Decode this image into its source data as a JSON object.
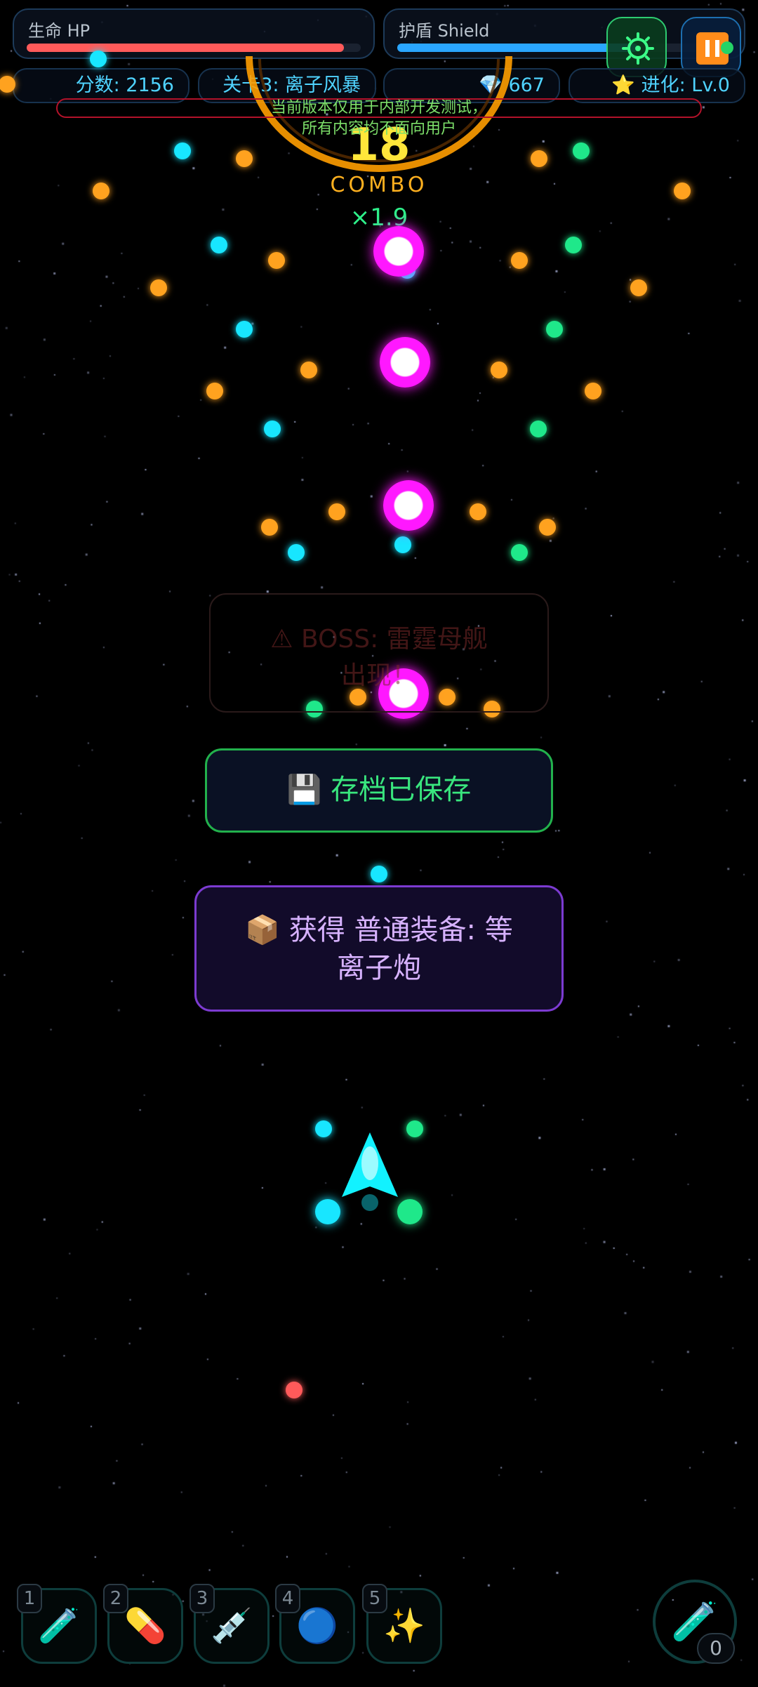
{
  "hud": {
    "hp_label": "生命 HP",
    "hp_fraction": 0.95,
    "shield_label": "护盾 Shield",
    "shield_fraction": 0.72,
    "score": "分数: 2156",
    "level": "关卡3: 离子风暴",
    "gems_icon": "💎",
    "gems_value": "667",
    "evolution_icon": "⭐",
    "evolution_value": "进化: Lv.0",
    "settings_icon": "gear-icon",
    "pause_icon": "pause-icon"
  },
  "notice": {
    "line1": "当前版本仅用于内部开发测试，",
    "line2": "所有内容均不面向用户"
  },
  "combo": {
    "count": "18",
    "label": "COMBO",
    "multiplier": "×1.9"
  },
  "boss_warning": {
    "line1": "⚠ BOSS: 雷霆母舰",
    "line2": "出现！"
  },
  "save_toast": {
    "icon": "💾",
    "text": "存档已保存"
  },
  "loot_toast": {
    "icon": "📦",
    "line1": "获得 普通装备: 等",
    "line2": "离子炮"
  },
  "skills": [
    {
      "key": "1",
      "icon": "🧪"
    },
    {
      "key": "2",
      "icon": "💊"
    },
    {
      "key": "3",
      "icon": "💉"
    },
    {
      "key": "4",
      "icon": "🔵"
    },
    {
      "key": "5",
      "icon": "✨"
    }
  ],
  "potion": {
    "icon": "🧪",
    "count": "0"
  },
  "colors": {
    "hp": "#ff5a5a",
    "shield": "#2aa6ff",
    "orange_bullet": "#ffa21f",
    "cyan_bullet": "#18e6ff",
    "green_bullet": "#1fe88a",
    "magenta_orb": "#ff18ff",
    "player": "#12f2ff",
    "accent_green": "#22b14c",
    "accent_purple": "#7c3bd1"
  }
}
